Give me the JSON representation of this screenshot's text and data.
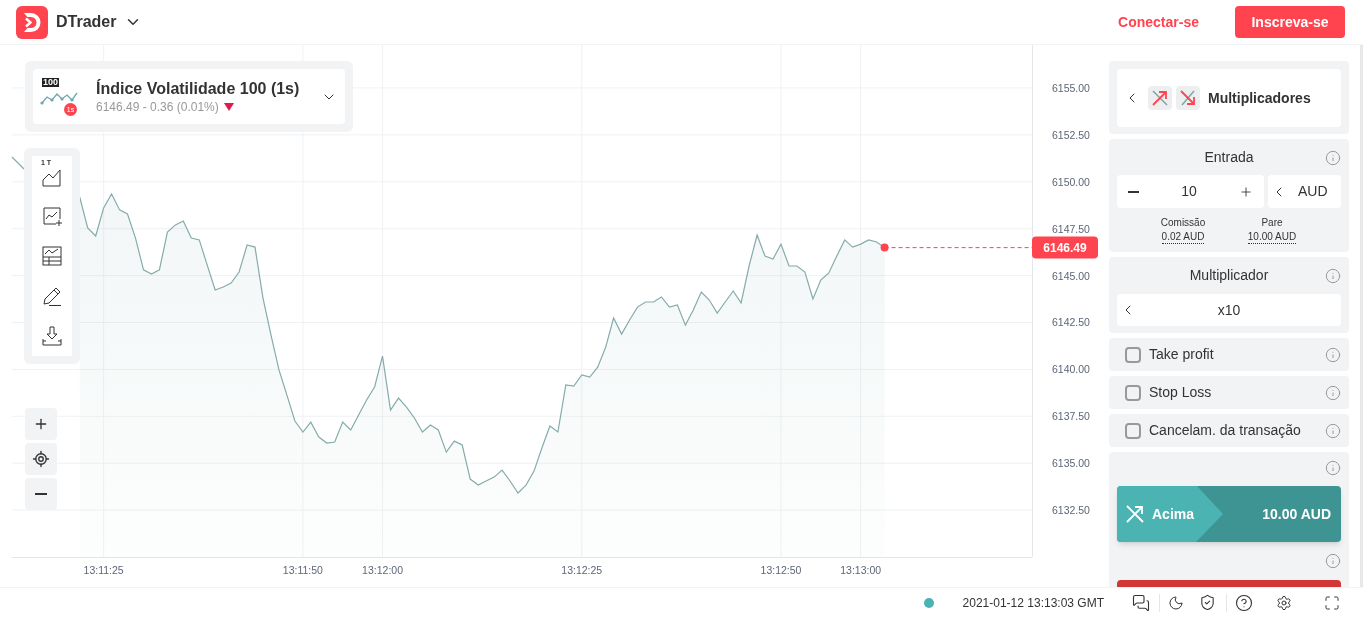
{
  "header": {
    "app_name": "DTrader",
    "login": "Conectar-se",
    "signup": "Inscreva-se"
  },
  "market": {
    "name": "Índice Volatilidade 100 (1s)",
    "icon_label": "100",
    "icon_badge": "1s",
    "quote": "6146.49 - 0.36 (0.01%)",
    "price_down": true
  },
  "chart_toolbar": {
    "chart_type_label": "1 T"
  },
  "chart": {
    "current_price": "6146.49",
    "chart_data": {
      "type": "area",
      "grid": true,
      "categories": [
        null,
        null,
        null,
        null,
        null,
        null,
        null,
        null,
        null,
        null,
        null,
        "13:11:25",
        null,
        null,
        null,
        null,
        null,
        null,
        null,
        null,
        null,
        null,
        null,
        null,
        null,
        null,
        null,
        null,
        null,
        null,
        null,
        null,
        null,
        null,
        null,
        null,
        "13:11:50",
        null,
        null,
        null,
        null,
        null,
        null,
        null,
        null,
        null,
        "13:12:00",
        null,
        null,
        null,
        null,
        null,
        null,
        null,
        null,
        null,
        null,
        null,
        null,
        null,
        null,
        null,
        null,
        null,
        null,
        null,
        null,
        null,
        null,
        null,
        null,
        "13:12:25",
        null,
        null,
        null,
        null,
        null,
        null,
        null,
        null,
        null,
        null,
        null,
        null,
        null,
        null,
        null,
        null,
        null,
        null,
        null,
        null,
        null,
        null,
        null,
        null,
        "13:12:50",
        null,
        null,
        null,
        null,
        null,
        null,
        null,
        null,
        null,
        "13:13:00",
        null,
        null,
        null,
        null,
        null,
        null,
        null,
        null,
        null,
        null,
        null,
        null,
        null,
        null,
        null,
        null,
        null,
        null,
        null,
        null,
        null
      ],
      "values": [
        null,
        null,
        null,
        null,
        null,
        null,
        null,
        null,
        6149.19,
        6147.54,
        6147.11,
        6148.6,
        6149.35,
        6148.5,
        6148.28,
        6147.0,
        6145.3,
        6145.08,
        6145.3,
        6147.32,
        6147.7,
        6147.91,
        6147.0,
        6146.9,
        6145.56,
        6144.23,
        6144.39,
        6144.6,
        6145.19,
        6146.63,
        6146.52,
        6143.8,
        6141.83,
        6139.97,
        6138.63,
        6137.25,
        6136.66,
        6137.19,
        6136.39,
        6136.07,
        6136.13,
        6137.19,
        6136.77,
        6137.57,
        6138.37,
        6139.06,
        6140.71,
        6137.83,
        6138.47,
        6137.99,
        6137.41,
        6136.66,
        6137.03,
        6136.77,
        6135.59,
        6136.18,
        6135.97,
        6134.15,
        6133.83,
        6134.05,
        6134.26,
        6134.63,
        6134.05,
        6133.41,
        6133.83,
        6134.58,
        6135.81,
        6136.98,
        6136.66,
        6139.17,
        6139.11,
        6139.7,
        6139.59,
        6140.12,
        6141.19,
        6142.74,
        6141.88,
        6142.63,
        6143.32,
        6143.59,
        6143.59,
        6143.86,
        6143.32,
        6143.43,
        6142.36,
        6143.16,
        6144.12,
        6143.7,
        6143.0,
        6143.59,
        6144.18,
        6143.54,
        6145.51,
        6147.16,
        6146.04,
        6145.88,
        6146.68,
        6145.51,
        6145.51,
        6145.19,
        6143.75,
        6144.76,
        6145.14,
        6146.04,
        6146.9,
        6146.52,
        6146.68,
        6146.9,
        6146.79,
        6146.49,
        null,
        null,
        null,
        null,
        null,
        null,
        null,
        null,
        null,
        null,
        null,
        null,
        null,
        null,
        null,
        null,
        null,
        null
      ],
      "ylim": [
        6130,
        6157.29
      ],
      "yticks": [
        {
          "value": 6132.5,
          "label": "6132.50"
        },
        {
          "value": 6135,
          "label": "6135.00"
        },
        {
          "value": 6137.5,
          "label": "6137.50"
        },
        {
          "value": 6140,
          "label": "6140.00"
        },
        {
          "value": 6142.5,
          "label": "6142.50"
        },
        {
          "value": 6145,
          "label": "6145.00"
        },
        {
          "value": 6147.5,
          "label": "6147.50"
        },
        {
          "value": 6150,
          "label": "6150.00"
        },
        {
          "value": 6152.5,
          "label": "6152.50"
        },
        {
          "value": 6155,
          "label": "6155.00"
        }
      ]
    }
  },
  "trade_type": {
    "name": "Multiplicadores"
  },
  "stake": {
    "title": "Entrada",
    "value": "10",
    "currency": "AUD",
    "commission_label": "Comissão",
    "commission": "0.02 AUD",
    "stop_out_label": "Pare",
    "stop_out": "10.00 AUD"
  },
  "multiplier": {
    "title": "Multiplicador",
    "value": "x10"
  },
  "options": [
    {
      "label": "Take profit",
      "checked": false
    },
    {
      "label": "Stop Loss",
      "checked": false
    },
    {
      "label": "Cancelam. da transação",
      "checked": false
    }
  ],
  "purchase": {
    "label": "Acima",
    "amount": "10.00 AUD"
  },
  "status_bar": {
    "connected": true,
    "time": "2021-01-12 13:13:03 GMT"
  }
}
